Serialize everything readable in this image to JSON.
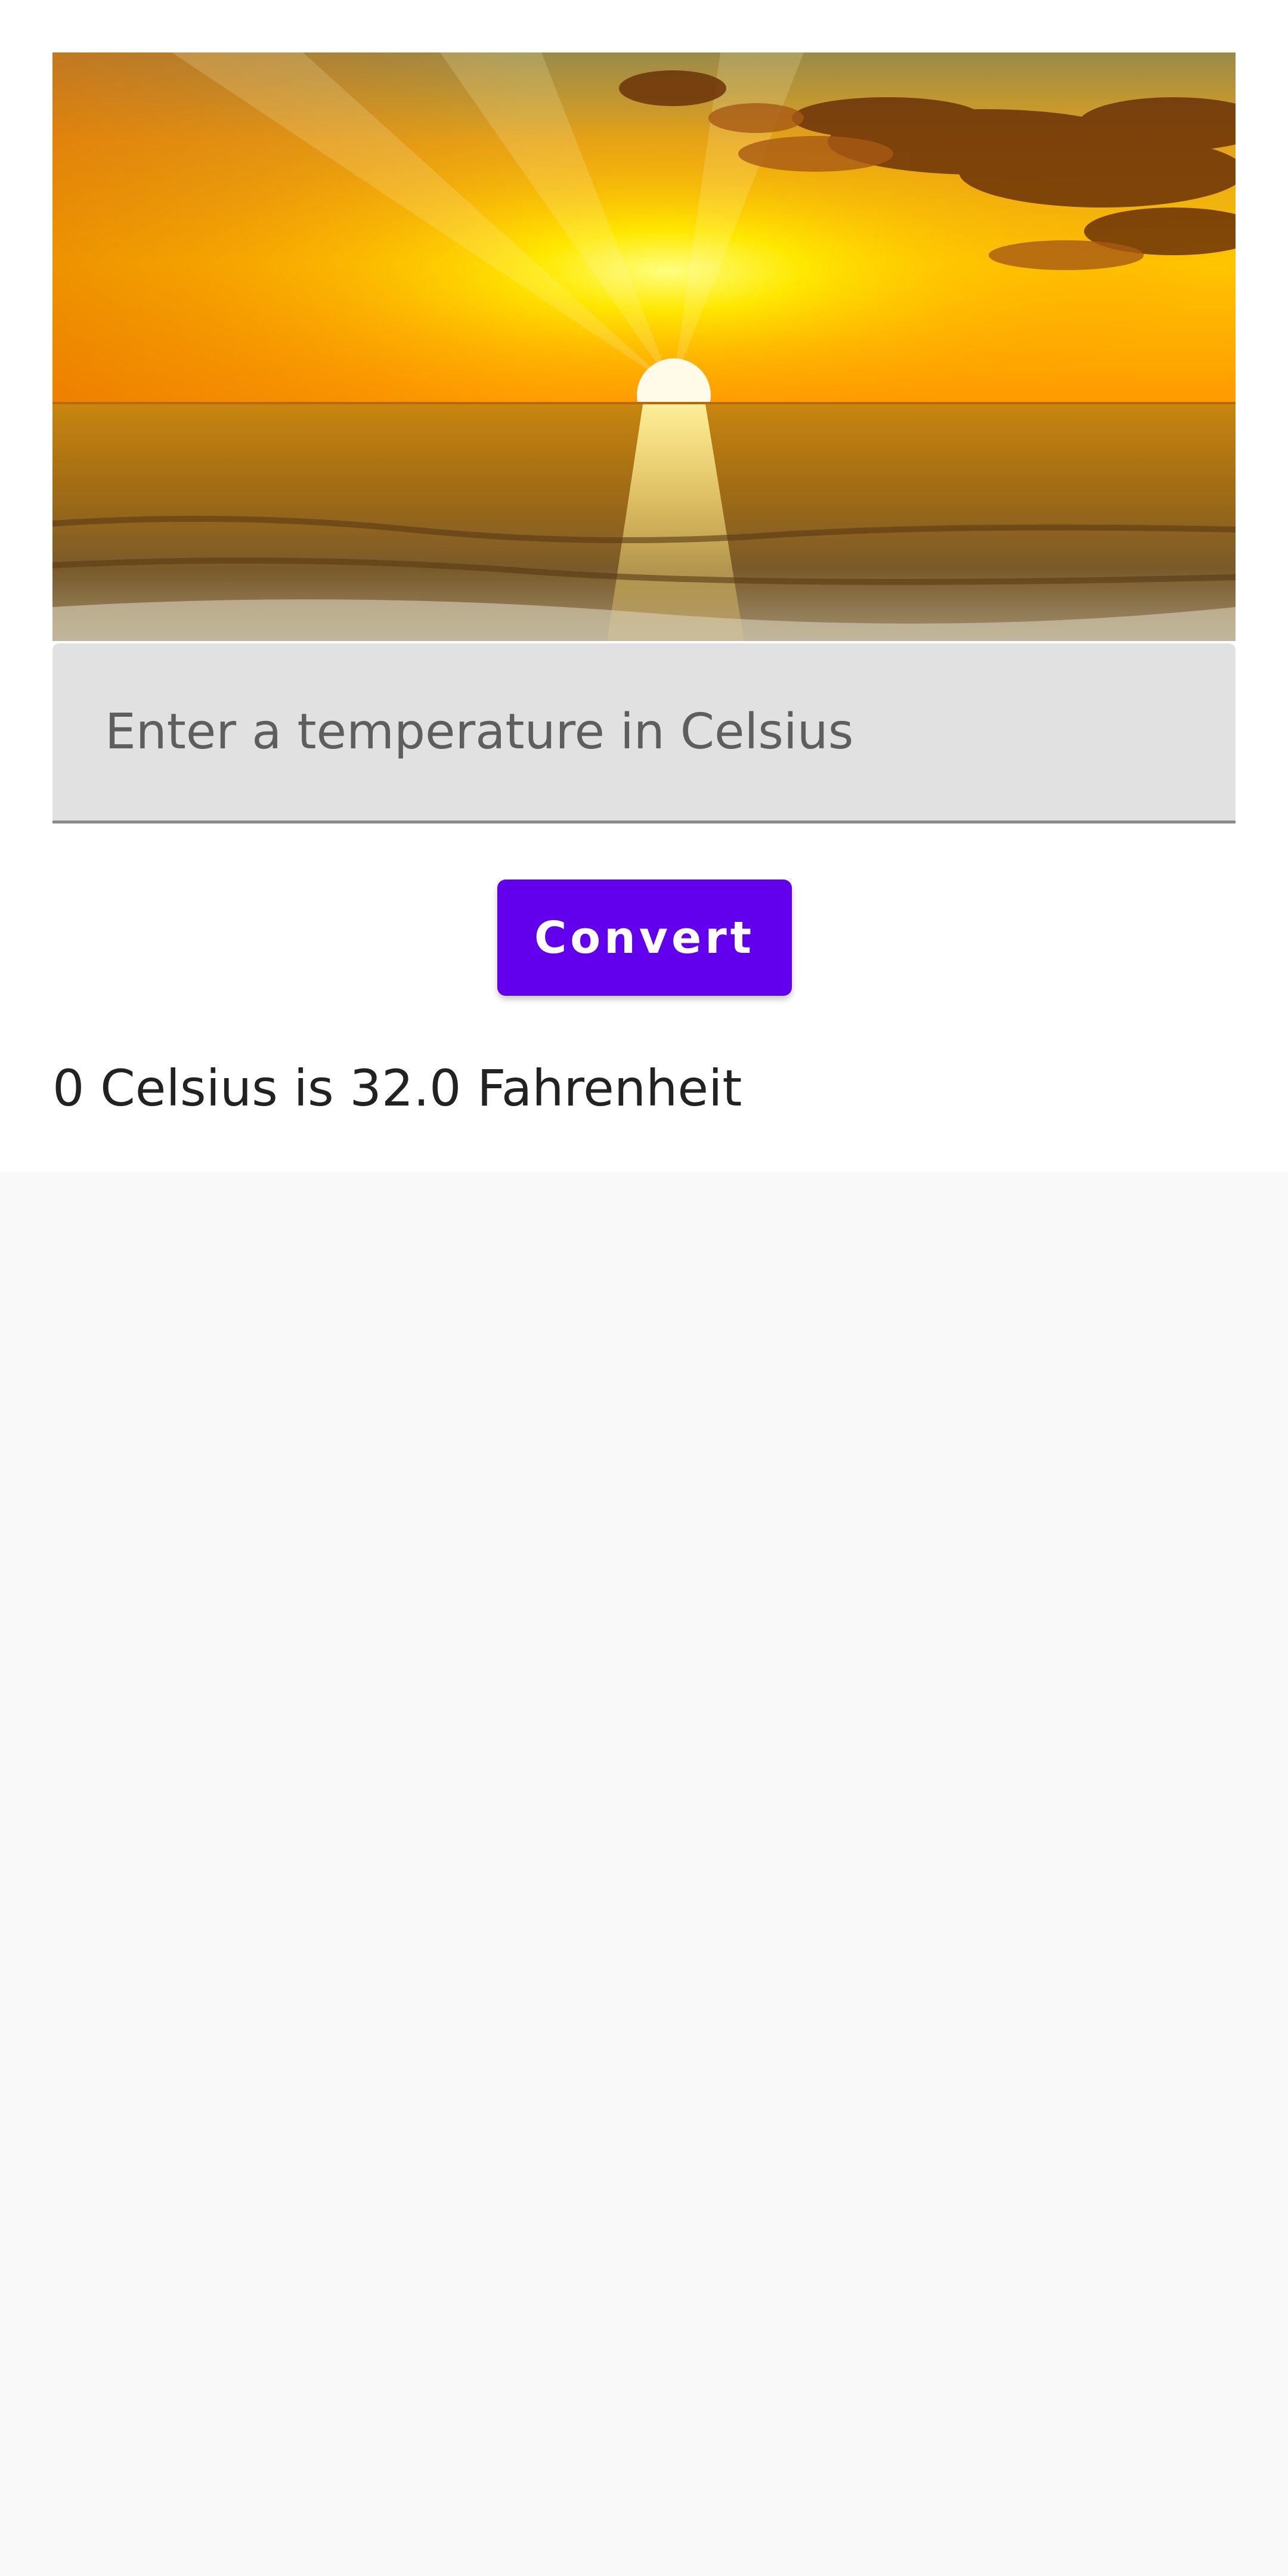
{
  "hero_image": {
    "icon": "sunset-over-sea-image",
    "colors": {
      "sky_top": "#8f7a3e",
      "sky_glow": "#ffd400",
      "sun": "#fffbe0",
      "sea": "#a8740f",
      "clouds": "#5a2a08"
    }
  },
  "temperature_input": {
    "placeholder": "Enter a temperature in Celsius",
    "value": ""
  },
  "convert_button": {
    "label": "Convert",
    "color": "#6200ee"
  },
  "result": {
    "text": "0 Celsius is 32.0 Fahrenheit"
  }
}
